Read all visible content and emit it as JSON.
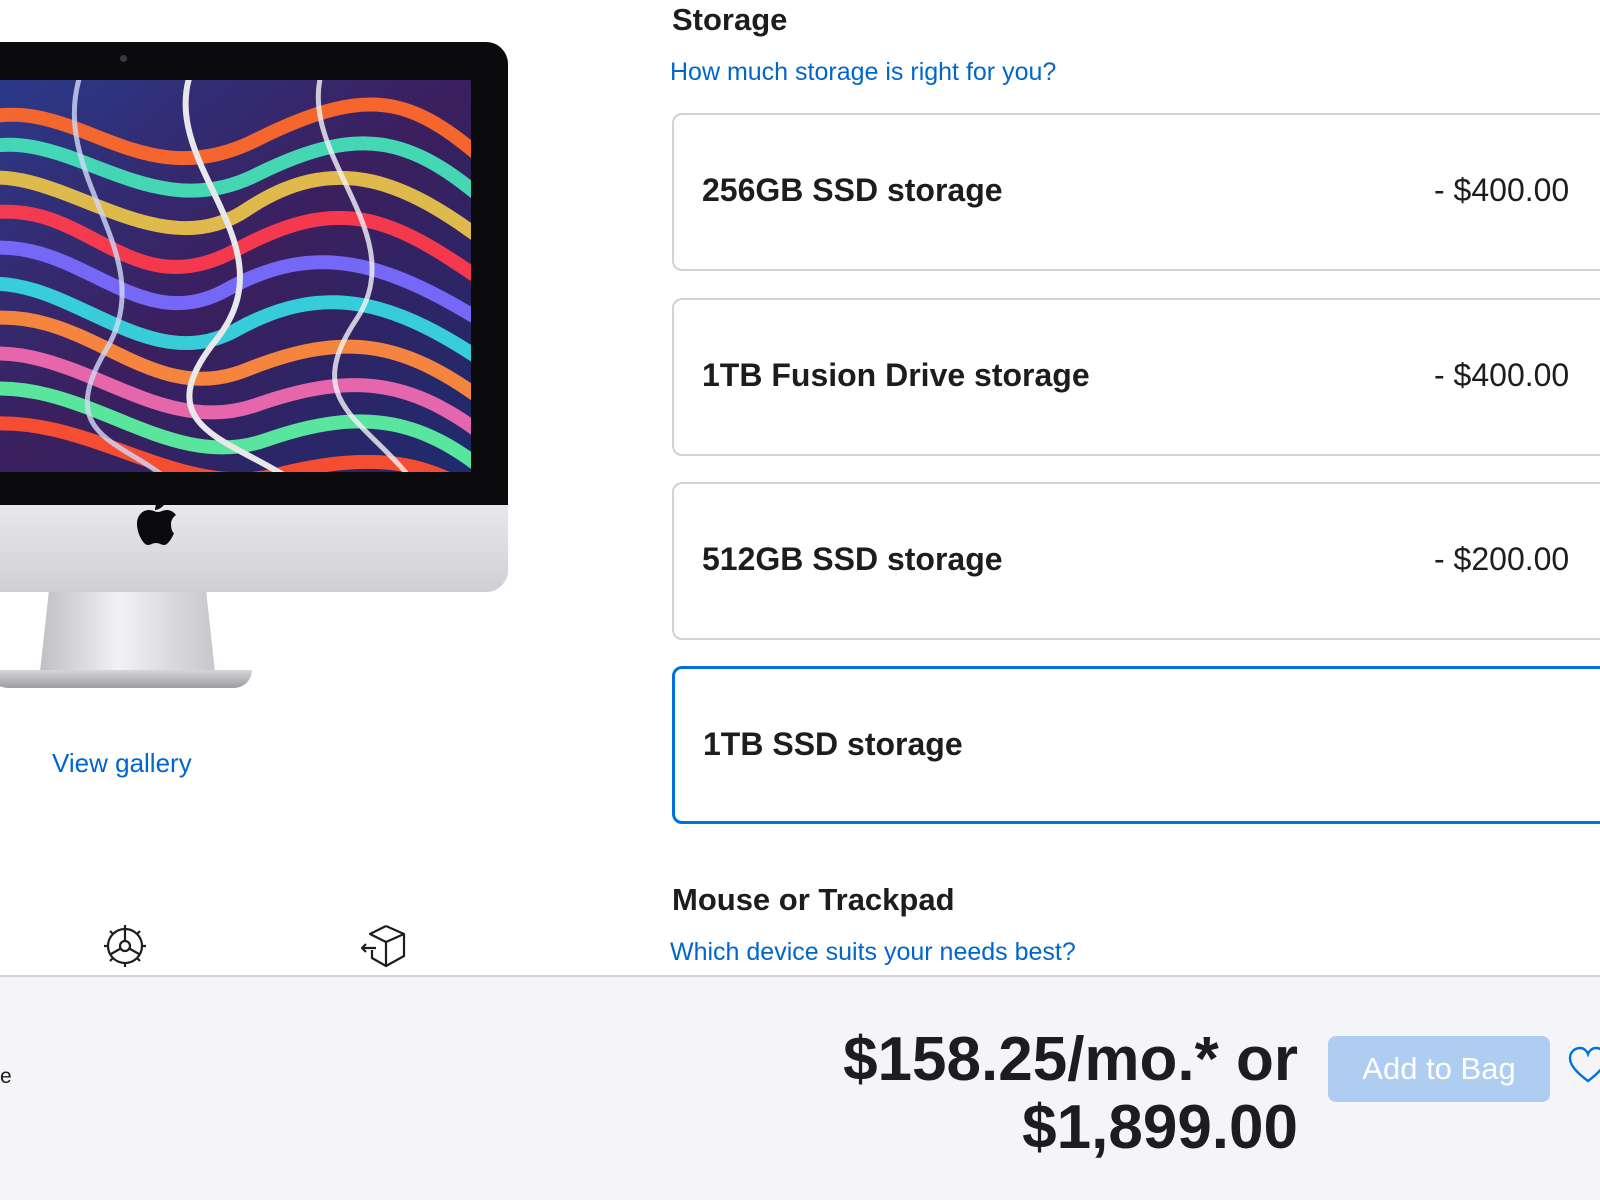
{
  "product": {
    "image": "imac-21-5-with-colorful-swirl-wallpaper",
    "view_gallery_label": "View gallery",
    "service_icons": [
      "gear-icon",
      "box-icon"
    ]
  },
  "storage": {
    "title": "Storage",
    "help_link": "How much storage is right for you?",
    "options": [
      {
        "name": "256GB SSD storage",
        "price": "- $400.00",
        "selected": false
      },
      {
        "name": "1TB Fusion Drive storage",
        "price": "- $400.00",
        "selected": false
      },
      {
        "name": "512GB SSD storage",
        "price": "- $200.00",
        "selected": false
      },
      {
        "name": "1TB SSD storage",
        "price": "",
        "selected": true
      }
    ]
  },
  "mouse": {
    "title": "Mouse or Trackpad",
    "help_link": "Which device suits your needs best?"
  },
  "summary": {
    "edge_text": "e",
    "monthly_price": "$158.25/mo.* or",
    "total_price": "$1,899.00",
    "add_to_bag_label": "Add to Bag"
  },
  "colors": {
    "link": "#0066cc",
    "selected_border": "#0071e3",
    "button_disabled": "#aecdf0",
    "summary_bg": "#f5f5f7"
  }
}
